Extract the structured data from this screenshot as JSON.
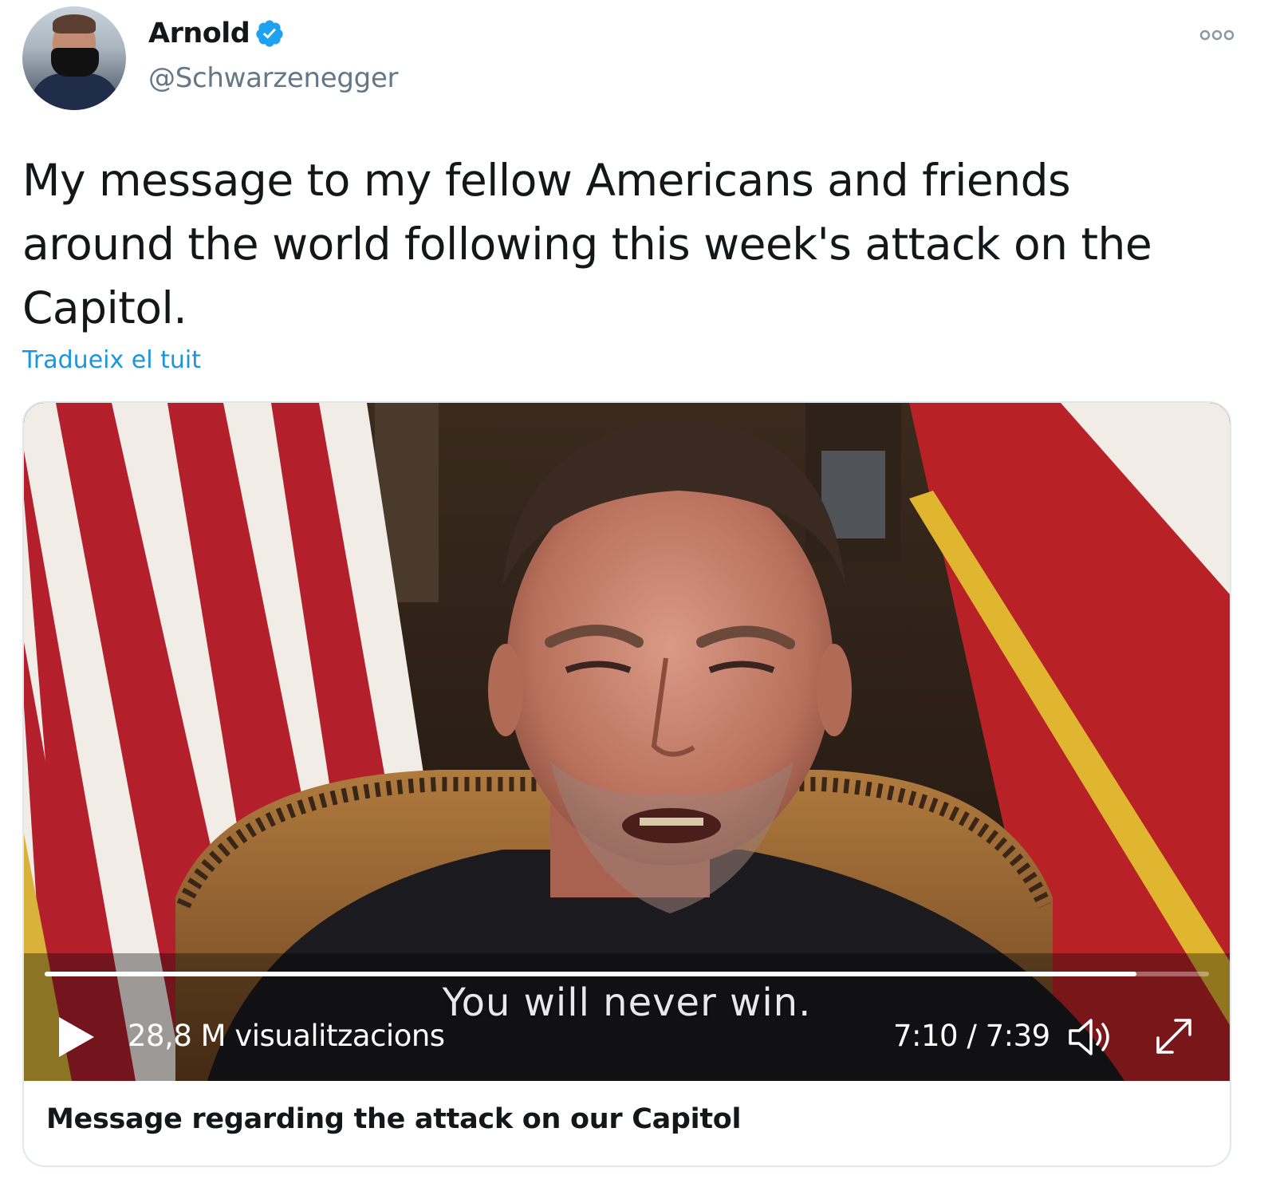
{
  "author": {
    "name": "Arnold",
    "handle": "@Schwarzenegger",
    "verified": true,
    "verified_color": "#1da1f2"
  },
  "tweet": {
    "text": "My message to my fellow Americans and friends around the world following this week's attack on the Capitol.",
    "translate_label": "Tradueix el tuit"
  },
  "video": {
    "subtitle": "You will never win.",
    "views": "28,8 M visualitzacions",
    "time": "7:10 / 7:39",
    "progress": 0.938,
    "play_icon": "play-icon",
    "volume_icon": "volume-icon",
    "fullscreen_icon": "fullscreen-icon"
  },
  "card": {
    "title": "Message regarding the attack on our Capitol"
  },
  "icons": {
    "more": "more-options-icon"
  },
  "colors": {
    "link": "#1b95e0",
    "handle": "#657786",
    "text": "#14171a",
    "border": "#e1e8ed"
  }
}
